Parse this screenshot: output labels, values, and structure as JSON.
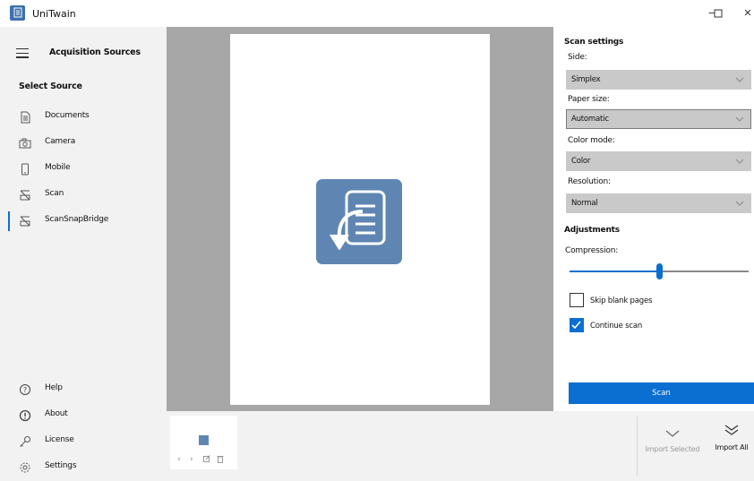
{
  "window": {
    "title": "UniTwain",
    "controls": {
      "minimize": "−",
      "maximize": "☐",
      "close": "✕"
    }
  },
  "sidebar": {
    "title": "Acquisition Sources",
    "select_source": "Select Source",
    "sources": [
      {
        "label": "Documents",
        "icon": "document-icon"
      },
      {
        "label": "Camera",
        "icon": "camera-icon"
      },
      {
        "label": "Mobile",
        "icon": "mobile-icon"
      },
      {
        "label": "Scan",
        "icon": "scanner-icon"
      },
      {
        "label": "ScanSnapBridge",
        "icon": "scanner-icon",
        "selected": true
      }
    ],
    "bottom": [
      {
        "label": "Help",
        "icon": "help-icon"
      },
      {
        "label": "About",
        "icon": "info-icon"
      },
      {
        "label": "License",
        "icon": "key-icon"
      },
      {
        "label": "Settings",
        "icon": "gear-icon"
      }
    ]
  },
  "settings": {
    "scan_settings_title": "Scan settings",
    "side_label": "Side:",
    "side_value": "Simplex",
    "paper_size_label": "Paper size:",
    "paper_size_value": "Automatic",
    "color_mode_label": "Color mode:",
    "color_mode_value": "Color",
    "resolution_label": "Resolution:",
    "resolution_value": "Normal",
    "adjustments_title": "Adjustments",
    "compression_label": "Compression:",
    "compression_level": 0.5,
    "skip_blank_label": "Skip blank pages",
    "skip_blank_checked": false,
    "continue_scan_label": "Continue scan",
    "continue_scan_checked": true,
    "scan_button": "Scan"
  },
  "import": {
    "selected_label": "Import Selected",
    "all_label": "Import All"
  },
  "colors": {
    "accent": "#0a6fd1",
    "sidebar_bg": "#f2f2f2",
    "preview_bg": "#a7a7a7",
    "logo_blue": "#5f86b3"
  }
}
